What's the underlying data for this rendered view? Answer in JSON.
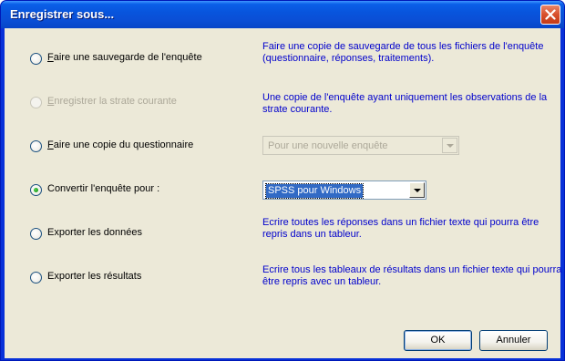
{
  "window": {
    "title": "Enregistrer sous..."
  },
  "options": [
    {
      "label": "Faire une sauvegarde de l'enquête",
      "mnemonic": "F",
      "rest": "aire une sauvegarde de l'enquête",
      "selected": false,
      "disabled": false,
      "description": "Faire une copie de sauvegarde de tous les fichiers de l'enquête (questionnaire, réponses, traitements)."
    },
    {
      "label": "Enregistrer la strate courante",
      "mnemonic": "E",
      "rest": "nregistrer la strate courante",
      "selected": false,
      "disabled": true,
      "description": "Une copie de l'enquête ayant uniquement les observations de la strate courante."
    },
    {
      "label": "Faire une copie du questionnaire",
      "mnemonic": "F",
      "rest": "aire une copie du questionnaire",
      "selected": false,
      "disabled": false,
      "combo_value": "Pour une nouvelle enquête"
    },
    {
      "label": "Convertir l'enquête pour :",
      "mnemonic": "",
      "rest": "Convertir l'enquête pour :",
      "selected": true,
      "disabled": false,
      "combo_value": "SPSS pour Windows"
    },
    {
      "label": "Exporter les données",
      "mnemonic": "",
      "rest": "Exporter les données",
      "selected": false,
      "disabled": false,
      "description": "Ecrire toutes les réponses dans un fichier texte qui pourra être repris dans un tableur."
    },
    {
      "label": "Exporter les résultats",
      "mnemonic": "",
      "rest": "Exporter les résultats",
      "selected": false,
      "disabled": false,
      "description": "Ecrire tous les tableaux de résultats dans un fichier texte qui pourra être repris avec un tableur."
    }
  ],
  "buttons": {
    "ok": "OK",
    "cancel": "Annuler"
  },
  "colors": {
    "description_text": "#0000cc",
    "dialog_bg": "#ece9d8",
    "titlebar": "#0a5fe8",
    "close_button": "#d8502c"
  },
  "icons": {
    "close": "close-icon",
    "dropdown": "chevron-down-icon"
  }
}
